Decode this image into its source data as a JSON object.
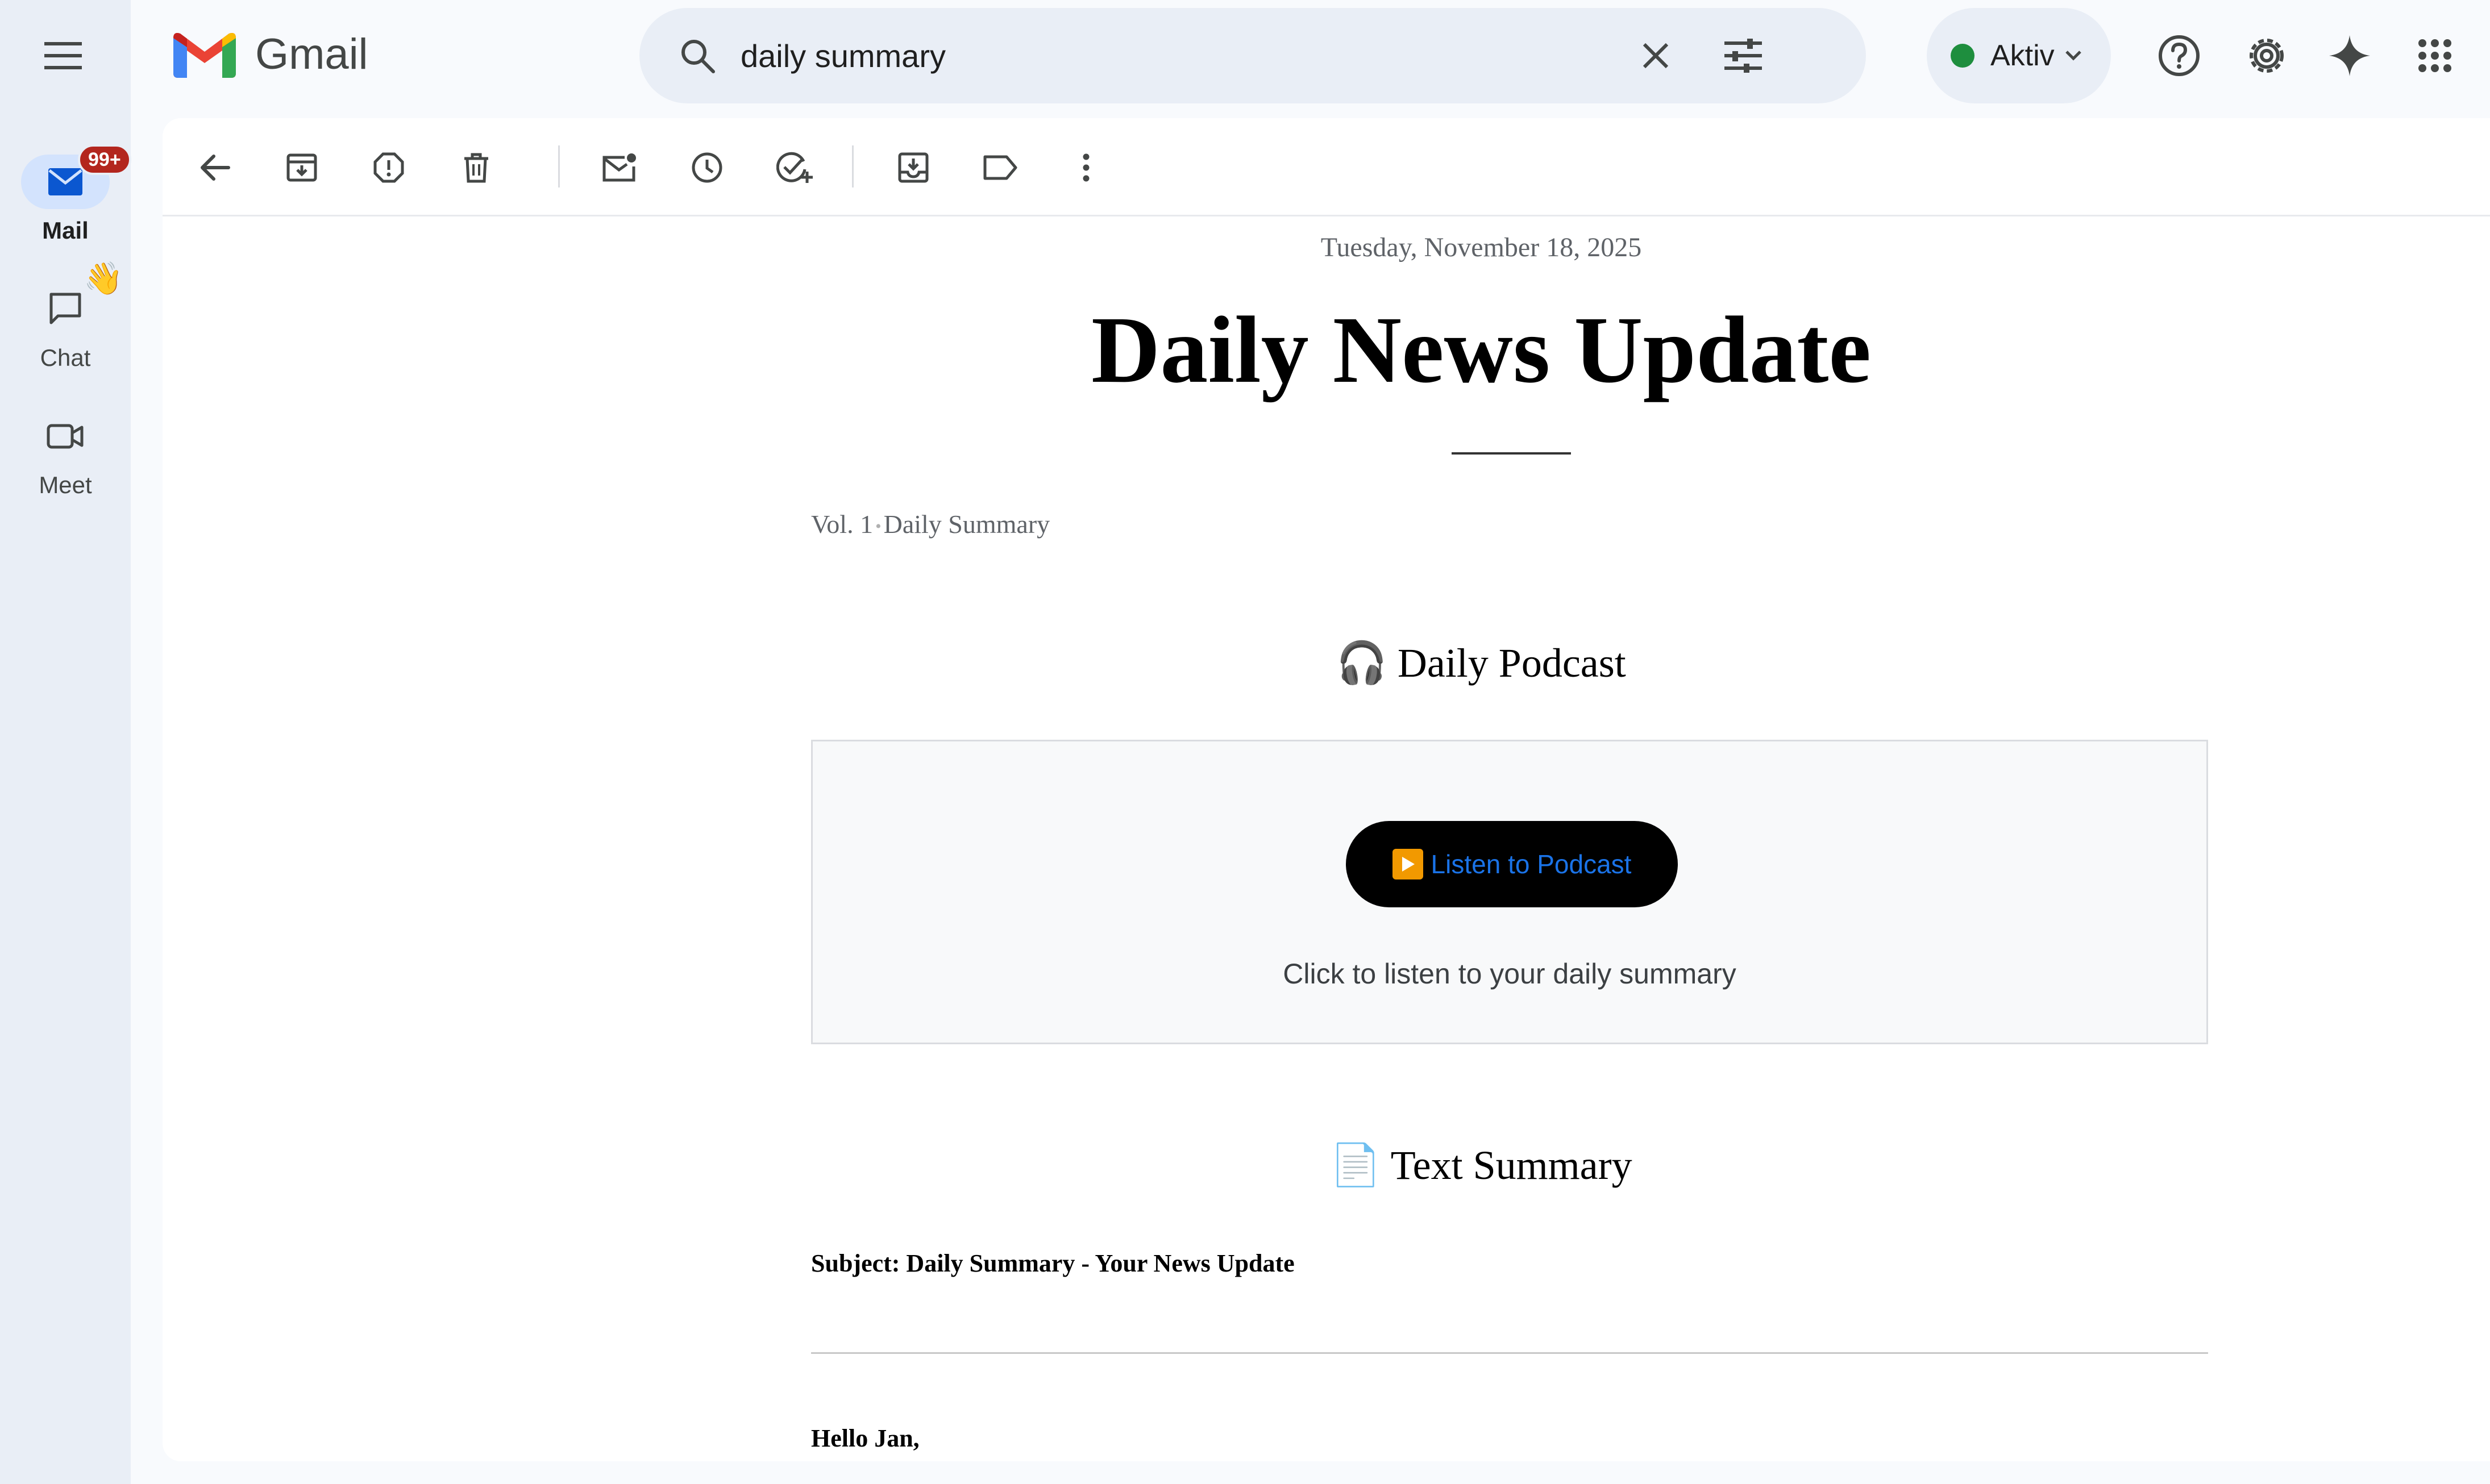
{
  "app": {
    "name": "Gmail"
  },
  "rail": {
    "items": [
      {
        "label": "Mail",
        "badge": "99+"
      },
      {
        "label": "Chat",
        "emoji": "👋"
      },
      {
        "label": "Meet"
      }
    ]
  },
  "search": {
    "query": "daily summary"
  },
  "status": {
    "label": "Aktiv",
    "color": "#1e8e3e"
  },
  "email": {
    "date": "Tuesday, November 18, 2025",
    "title": "Daily News Update",
    "volume": "Vol. 1",
    "volume_sep": "•",
    "volume_label": "Daily Summary",
    "podcast_heading_icon": "🎧",
    "podcast_heading": "Daily Podcast",
    "podcast_button_icon": "▶",
    "podcast_button": "Listen to Podcast",
    "podcast_hint": "Click to listen to your daily summary",
    "summary_heading_icon": "📄",
    "summary_heading": "Text Summary",
    "subject": "Subject: Daily Summary - Your News Update",
    "greeting": "Hello Jan,"
  },
  "colors": {
    "rail_bg": "#e9eef6",
    "active_pill": "#d3e3fd",
    "badge": "#b3261e",
    "link": "#1a73e8"
  }
}
